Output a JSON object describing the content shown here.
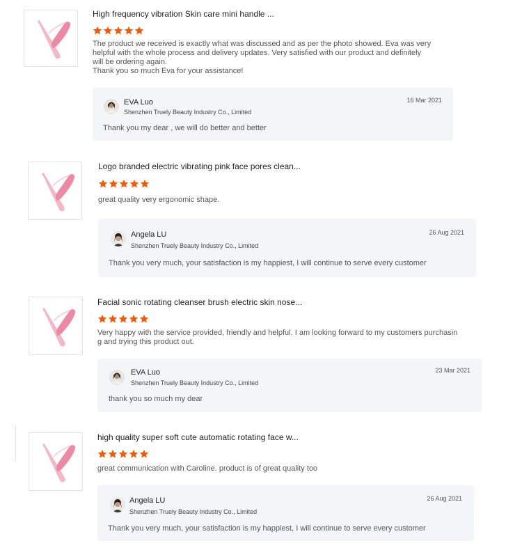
{
  "colors": {
    "star": "#f05a0a",
    "reply_bg": "#f4f5f7",
    "product_pink": "#ee9db3"
  },
  "reviews": [
    {
      "title": "High frequency vibration Skin care mini handle ...",
      "rating": 5,
      "text": "The product we received is exactly what was discussed and as per the photo showed. Eva was very helpful with the whole process and delivery updates. Very satisfied with our product and definitely will be ordering again.\nThank you so much Eva for your assistance!",
      "reply": {
        "name": "EVA Luo",
        "company": "Shenzhen Truely Beauty Industry Co., Limited",
        "date": "16 Mar 2021",
        "text": "Thank  you  my dear , we will do better and better"
      }
    },
    {
      "title": "Logo branded electric vibrating pink face pores clean...",
      "rating": 5,
      "text": "great quality very ergonomic shape.",
      "reply": {
        "name": "Angela LU",
        "company": "Shenzhen Truely Beauty Industry Co., Limited",
        "date": "26 Aug 2021",
        "text": "Thank you very much, your satisfaction is my happiest, I will continue to serve every customer"
      }
    },
    {
      "title": "Facial sonic rotating cleanser brush electric skin nose...",
      "rating": 5,
      "text": "Very happy with the service provided, friendly and helpful. I am looking forward to my customers purchasin\ng and trying this product out.",
      "reply": {
        "name": "EVA Luo",
        "company": "Shenzhen Truely Beauty Industry Co., Limited",
        "date": "23 Mar 2021",
        "text": "thank you so much my dear"
      }
    },
    {
      "title": "high quality super soft cute automatic rotating face w...",
      "rating": 5,
      "text": "great communication with Caroline. product is of great quality too",
      "reply": {
        "name": "Angela LU",
        "company": "Shenzhen Truely Beauty Industry Co., Limited",
        "date": "26 Aug 2021",
        "text": "Thank you very much, your satisfaction is my happiest, I will continue to serve every customer"
      }
    }
  ]
}
